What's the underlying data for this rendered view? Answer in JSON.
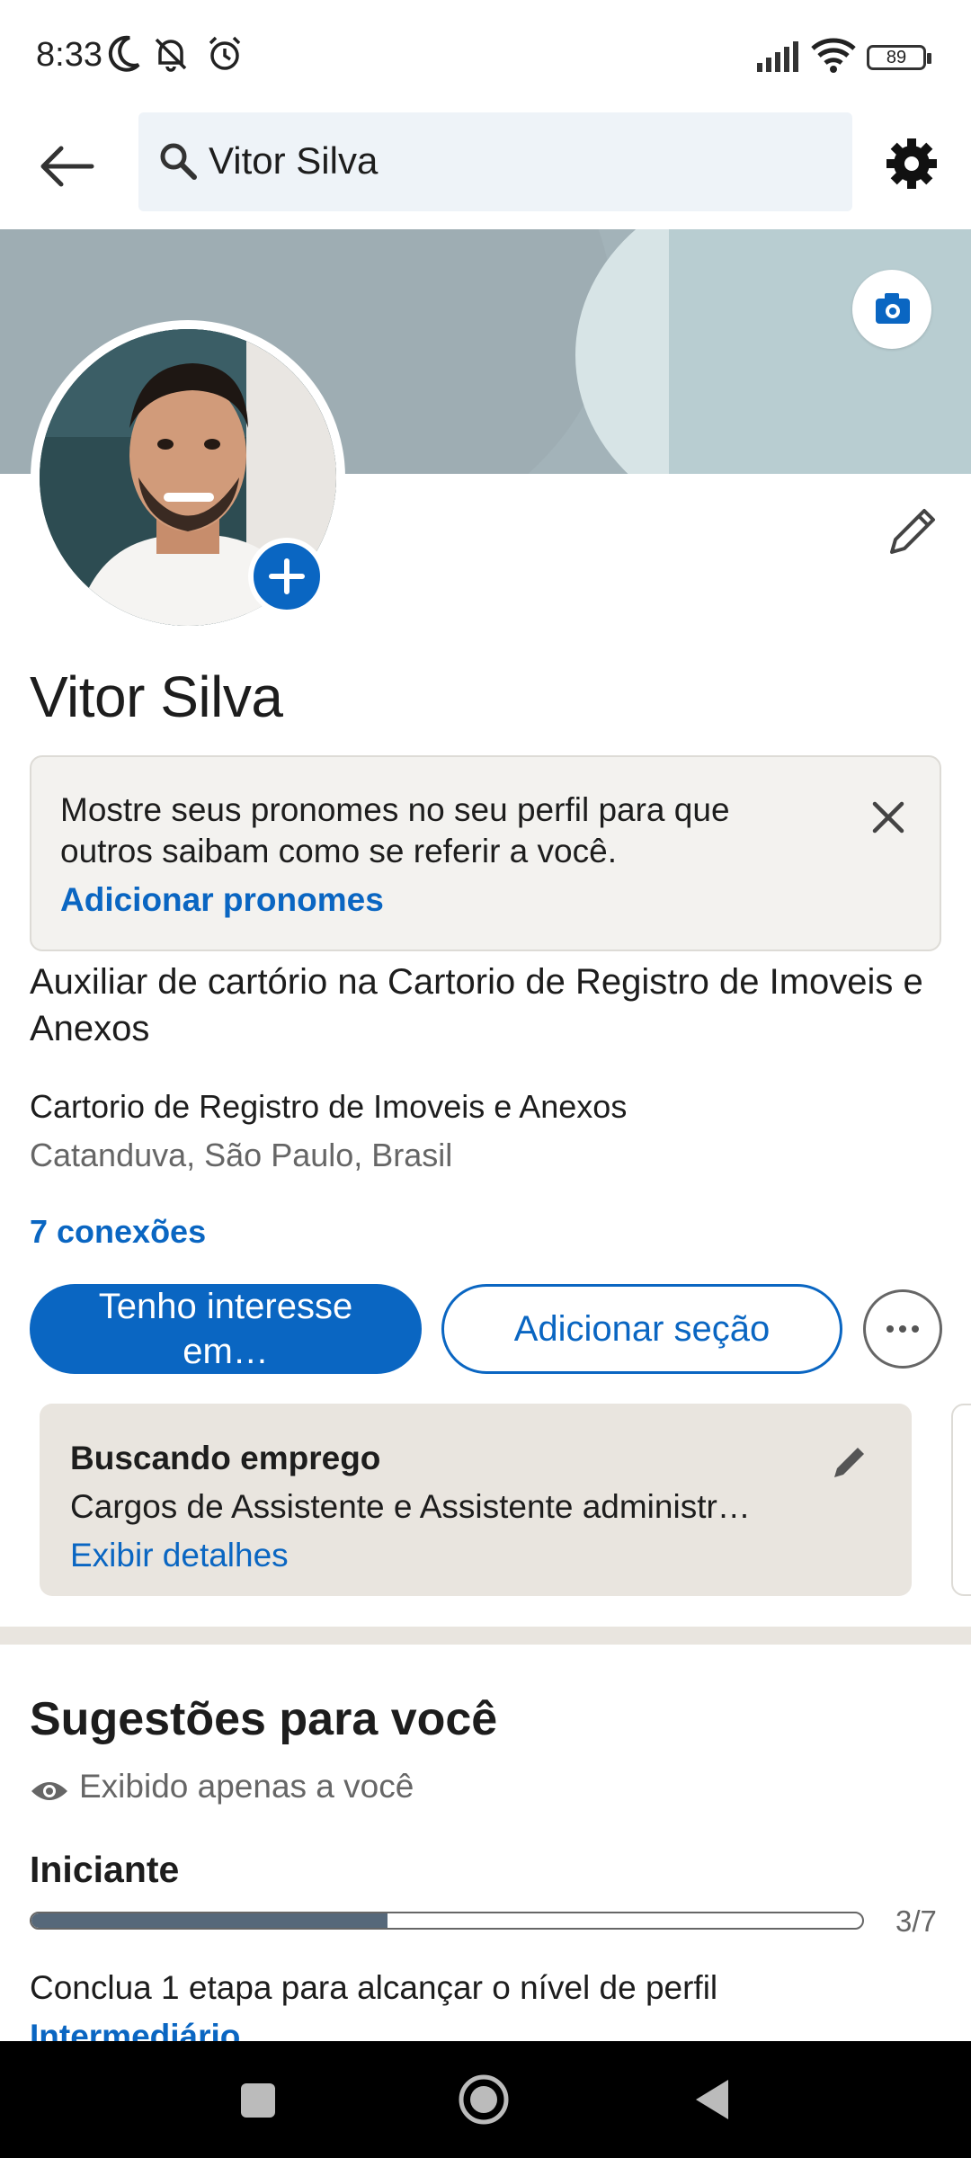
{
  "status_bar": {
    "time": "8:33",
    "battery": "89",
    "icons": [
      "moon-icon",
      "muted-bell-icon",
      "alarm-icon",
      "signal-icon",
      "wifi-icon",
      "battery-icon"
    ]
  },
  "header": {
    "search_value": "Vitor Silva",
    "icons": [
      "back-arrow-icon",
      "search-icon",
      "gear-icon"
    ]
  },
  "profile": {
    "name": "Vitor Silva",
    "pronoun_prompt": "Mostre seus pronomes no seu perfil para que outros saibam como se referir a você.",
    "pronoun_link": "Adicionar pronomes",
    "headline": "Auxiliar de cartório na Cartorio de Registro de Imoveis e Anexos",
    "company": "Cartorio de Registro de Imoveis e Anexos",
    "location": "Catanduva, São Paulo, Brasil",
    "connections": "7 conexões"
  },
  "actions": {
    "open_to": "Tenho interesse em…",
    "add_section": "Adicionar seção"
  },
  "open_to_work": {
    "title": "Buscando emprego",
    "detail": "Cargos de Assistente e Assistente administr…",
    "link": "Exibir detalhes"
  },
  "suggestions": {
    "title": "Sugestões para você",
    "private_note": "Exibido apenas a você",
    "level": "Iniciante",
    "progress_count": "3/7",
    "progress_fraction": 0.4286,
    "next_step": "Conclua 1 etapa para alcançar o nível de perfil",
    "next_level": "Intermediário"
  },
  "colors": {
    "accent": "#0a66c2",
    "cover": "#a3b3b9",
    "card": "#e9e5df",
    "progress": "#56687a"
  }
}
